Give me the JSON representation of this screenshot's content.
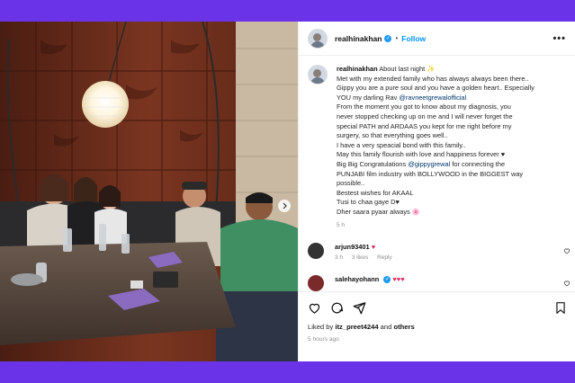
{
  "post": {
    "username": "realhinakhan",
    "follow_label": "Follow",
    "more_label": "•••",
    "separator": "•",
    "verified_glyph": "✓"
  },
  "caption": {
    "lines": [
      "About last night ✨",
      "Met with my extended family who has always always been there..",
      "Gippy you are a pure soul and you have a golden heart.. Especially",
      "YOU my darling Rav",
      "From the moment you got to know about my diagnosis, you",
      "never stopped checking up on me and I will never forget the",
      "special PATH and ARDAAS you kept for me right before my",
      "surgery, so that everything goes well..",
      "I have a very speacial bond with this family..",
      "May this family flourish with love and happiness forever ♥",
      "Big Big Congratulations",
      "PUNJABI film industry with BOLLYWOOD in the BIGGEST way",
      "possible..",
      "Bestest wishes for AKAAL",
      "Tusi to chaa gaye D♥",
      "Dher saara pyaar always 🌸"
    ],
    "mention_rav": "@ravneetgrewalofficial",
    "mention_gippy": "@gippygrewal",
    "congrats_tail": "for connecting the",
    "time": "5 h"
  },
  "comments": [
    {
      "user": "arjun93401",
      "text": "♥",
      "time": "3 h",
      "likes": "3 likes",
      "reply": "Reply"
    },
    {
      "user": "salehayohann",
      "text": "♥♥♥"
    }
  ],
  "actions": {
    "liked_by_prefix": "Liked by",
    "liked_by_user": "itz_preet4244",
    "liked_by_and": "and",
    "liked_by_others": "others",
    "posted_ago": "5 hours ago"
  },
  "colors": {
    "background": "#6a33e8",
    "link": "#0095f6",
    "mention": "#00376b",
    "heart": "#e0245e"
  },
  "icons": [
    "heart-icon",
    "comment-icon",
    "share-icon",
    "bookmark-icon",
    "verified-icon",
    "next-arrow-icon"
  ]
}
